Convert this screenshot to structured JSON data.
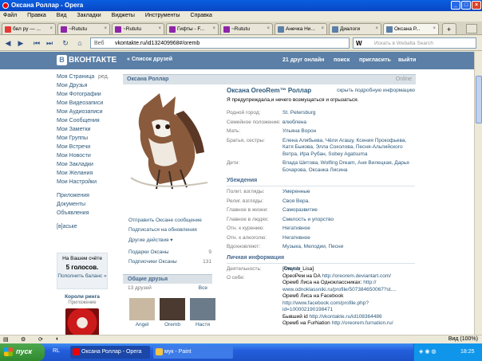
{
  "window": {
    "title": "Оксана Роллар - Opera"
  },
  "menu": [
    "Файл",
    "Правка",
    "Вид",
    "Закладки",
    "Виджеты",
    "Инструменты",
    "Справка"
  ],
  "tabs": [
    {
      "label": "бел ру — ...",
      "color": "#e53935"
    },
    {
      "label": "~Rututu",
      "color": "#8e24aa"
    },
    {
      "label": "~Rututu",
      "color": "#8e24aa"
    },
    {
      "label": "Гифты - F...",
      "color": "#8e24aa"
    },
    {
      "label": "~Rututu",
      "color": "#8e24aa"
    },
    {
      "label": "Анечка Ни...",
      "color": "#5b7fa6"
    },
    {
      "label": "Диалоги",
      "color": "#5b7fa6"
    },
    {
      "label": "Оксана Р...",
      "color": "#5b7fa6"
    }
  ],
  "address": {
    "web": "Веб",
    "url": "vkontakte.ru/id132409968#/oremb",
    "search_placeholder": "Искать в Webalta Search",
    "search_engine": "W"
  },
  "vk": {
    "logo": "ВКОНТАКТЕ",
    "friends_list": "« Список друзей",
    "online_count": "21 друг онлайн",
    "search": "поиск",
    "invite": "пригласить",
    "logout": "выйти",
    "nav": [
      "Моя Страница",
      "Мои Друзья",
      "Мои Фотографии",
      "Мои Видеозаписи",
      "Мои Аудиозаписи",
      "Мои Сообщения",
      "Мои Заметки",
      "Мои Группы",
      "Мои Встречи",
      "Мои Новости",
      "Мои Закладки",
      "Мои Желания",
      "Мои Настройки"
    ],
    "edit": "ред.",
    "nav2": [
      "Приложения",
      "Документы",
      "Объявления"
    ],
    "nav3": "[в]аське",
    "balance": {
      "label": "На Вашем счёте",
      "amount": "5 голосов.",
      "refill": "Пополнить баланс »"
    },
    "promo": {
      "title": "Короли ринга",
      "sub": "Приложение"
    }
  },
  "profile": {
    "header_name": "Оксана Роллар",
    "online": "Online",
    "full_name": "Оксана OreoRem™ Роллар",
    "more_info": "скрыть подробную информацию",
    "status": "Я предупреждала,и нечего возмущаться и огрызаться.",
    "actions": [
      "Отправить Оксане сообщение",
      "Подписаться на обновления",
      "Другие действия ▾"
    ],
    "gifts": {
      "label": "Подарки Оксаны",
      "count": "9"
    },
    "subscribers": {
      "label": "Подписчики Оксаны",
      "count": "131"
    },
    "common_friends": {
      "title": "Общие друзья",
      "count": "13 друзей",
      "all": "Все"
    },
    "friends": [
      {
        "name": "Angel",
        "color": "#c9b9a3"
      },
      {
        "name": "Oremb",
        "color": "#4a3a30"
      },
      {
        "name": "Настя",
        "color": "#6c7b8a"
      }
    ],
    "rows": [
      {
        "label": "Родной город:",
        "value": "St. Petersburg"
      },
      {
        "label": "Семейное положение:",
        "value": "влюблена"
      },
      {
        "label": "Мать:",
        "value": "Ульяна Ворон"
      },
      {
        "label": "Братья, сестры:",
        "value": "Елена Алябьева, Чёли Агашу, Ксения Прокофьева, Катя Быкова, Элла Соколова, Песня-Альпийского Ветра, Ира Рубан, Sobey Agatsuma"
      },
      {
        "label": "Дети:",
        "value": "Влада Шитова, Wolfing Dream, Аня Вилецкая, Дарья Бочарова, Оксанка Лисина"
      }
    ],
    "beliefs_title": "Убеждения",
    "beliefs": [
      {
        "label": "Полит. взгляды:",
        "value": "Умеренные"
      },
      {
        "label": "Религ. взгляды:",
        "value": "Своя Вера."
      },
      {
        "label": "Главное в жизни:",
        "value": "Саморазвитие"
      },
      {
        "label": "Главное в людях:",
        "value": "Смелость и упорство"
      },
      {
        "label": "Отн. к курению:",
        "value": "Негативное"
      },
      {
        "label": "Отн. к алкоголю:",
        "value": "Негативное"
      },
      {
        "label": "Вдохновляют:",
        "value": "Музыка, Мелодии, Песни"
      }
    ],
    "personal_title": "Личная информация",
    "activity": {
      "label": "Деятельность:",
      "value": "Рисуем"
    },
    "about_label": "О себе:",
    "about": [
      {
        "text": "[Oremb_Lisa]",
        "link": ""
      },
      {
        "text": "ОреоРем на DA ",
        "link": "http://oreorem.deviantart.com/"
      },
      {
        "text": "Оремб Лиса на Одноклассниках: ",
        "link": "http://"
      },
      {
        "text": "",
        "link": "www.odnoklassniki.ru/profile/507384650067?st...."
      },
      {
        "text": "Оремб Лиса на Facebook",
        "link": ""
      },
      {
        "text": "",
        "link": "http://www.facebook.com/profile.php?"
      },
      {
        "text": "",
        "link": "id=100002190198471"
      },
      {
        "text": "Бывший id ",
        "link": "http://vkontakte.ru/id108364486"
      },
      {
        "text": "Оремб на FurNation ",
        "link": "http://oreorem.furnation.ru/"
      }
    ]
  },
  "statusbar": {
    "view": "Вид (100%)"
  },
  "taskbar": {
    "start": "пуск",
    "lang": "RL",
    "items": [
      "Оксана Роллар - Opera",
      "мук - Paint"
    ],
    "time": "18:25"
  }
}
